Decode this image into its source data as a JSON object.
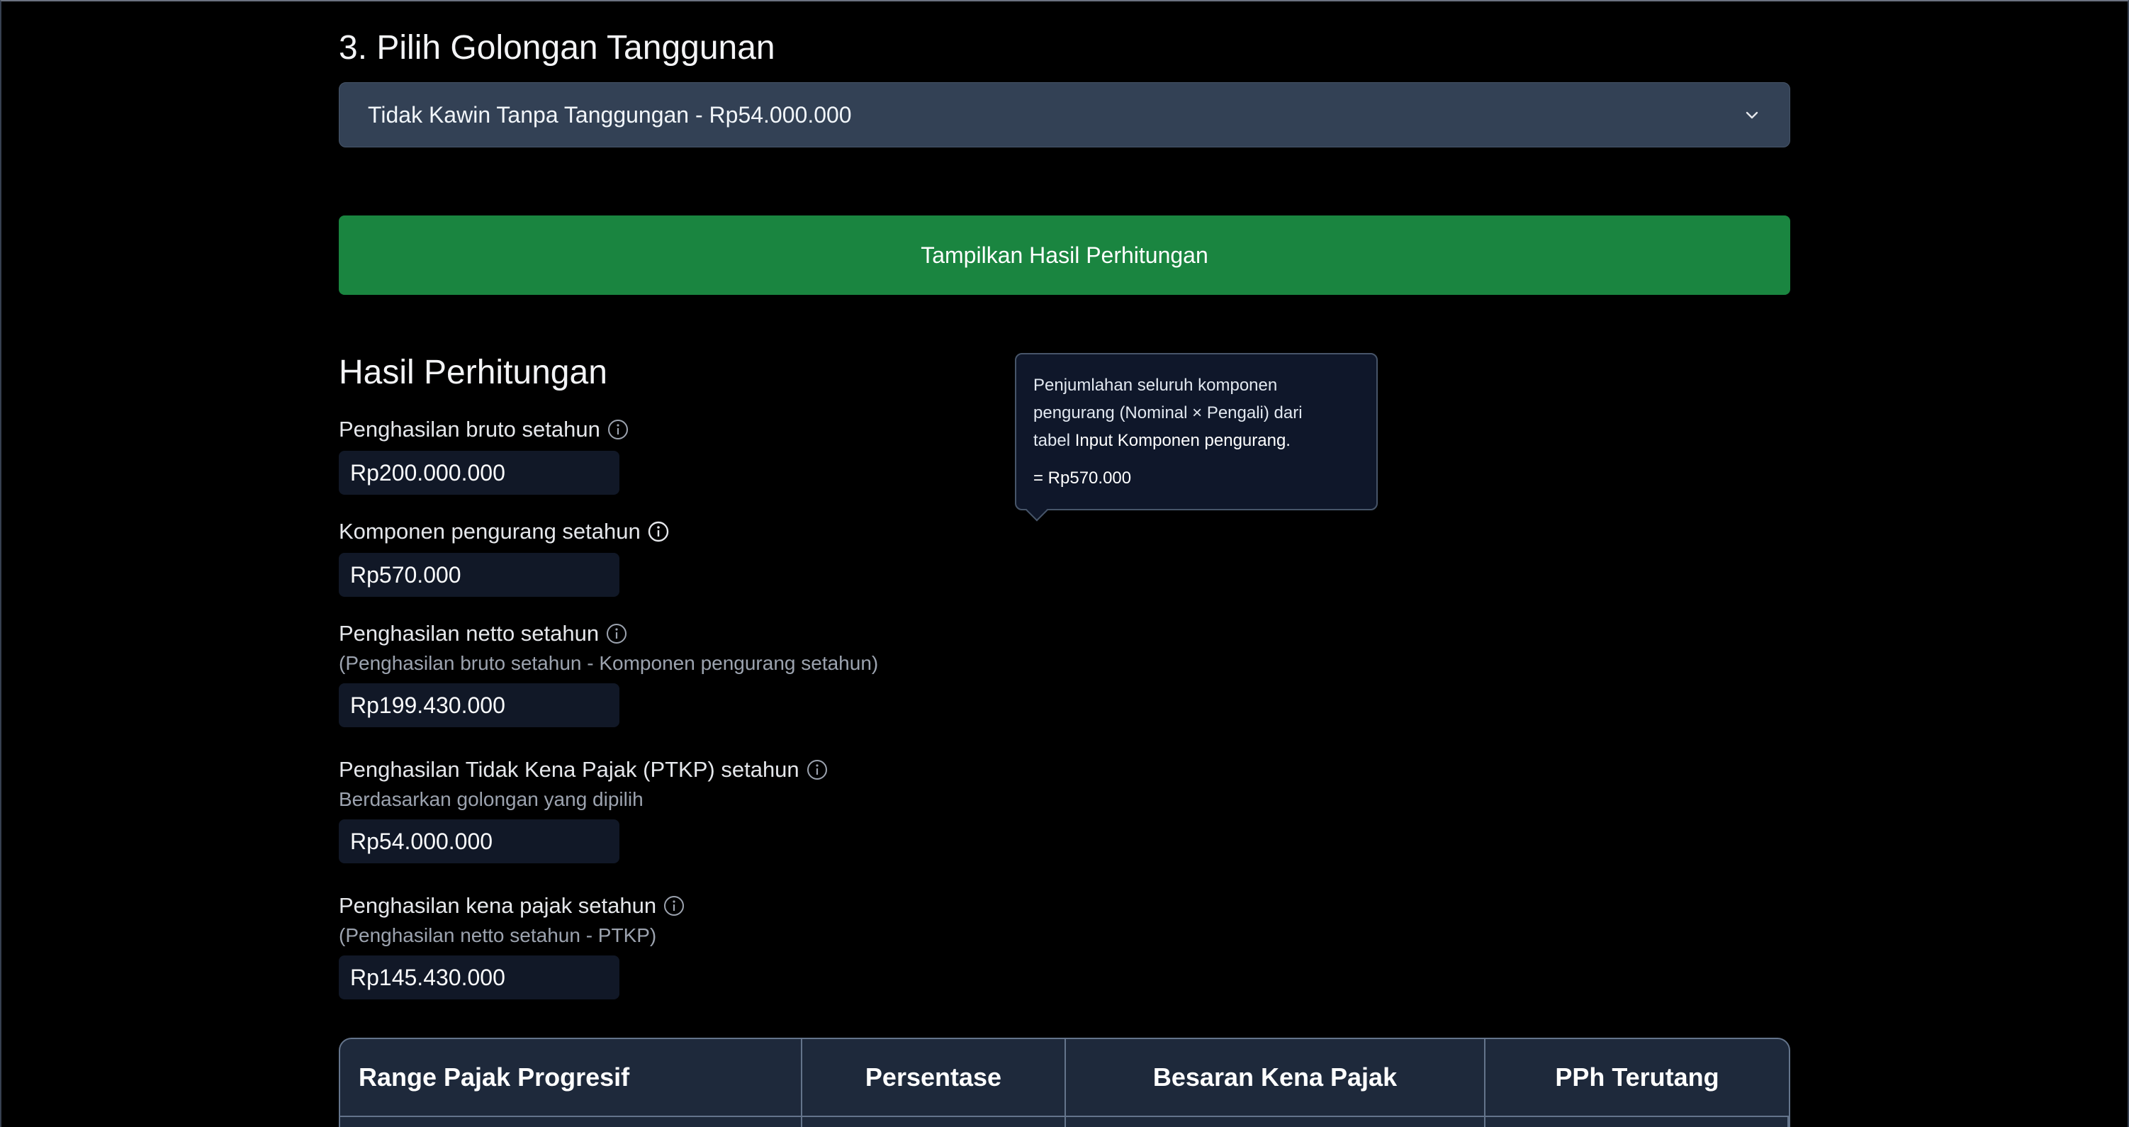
{
  "section3": {
    "title": "3. Pilih Golongan Tanggunan",
    "select_value": "Tidak Kawin Tanpa Tanggungan - Rp54.000.000"
  },
  "submit_label": "Tampilkan Hasil Perhitungan",
  "results": {
    "title": "Hasil Perhitungan",
    "gross": {
      "label": "Penghasilan bruto setahun",
      "value": "Rp200.000.000"
    },
    "deductions": {
      "label": "Komponen pengurang setahun",
      "value": "Rp570.000"
    },
    "net": {
      "label": "Penghasilan netto setahun",
      "subtitle": "(Penghasilan bruto setahun - Komponen pengurang setahun)",
      "value": "Rp199.430.000"
    },
    "ptkp": {
      "label": "Penghasilan Tidak Kena Pajak (PTKP) setahun",
      "subtitle": "Berdasarkan golongan yang dipilih",
      "value": "Rp54.000.000"
    },
    "taxable": {
      "label": "Penghasilan kena pajak setahun",
      "subtitle": "(Penghasilan netto setahun - PTKP)",
      "value": "Rp145.430.000"
    }
  },
  "tooltip": {
    "line1": "Penjumlahan seluruh komponen",
    "line2": "pengurang (Nominal × Pengali) dari",
    "line3_prefix": "tabel ",
    "line3_highlight": "Input Komponen pengurang.",
    "result": "= Rp570.000"
  },
  "table": {
    "headers": [
      "Range Pajak Progresif",
      "Persentase",
      "Besaran Kena Pajak",
      "PPh Terutang"
    ]
  },
  "colors": {
    "background": "#000000",
    "select_bg": "#334155",
    "button_green": "#1a8540",
    "value_box": "#111827",
    "table_header_bg": "#1e293b"
  },
  "icons": {
    "info": "info-circle-icon",
    "dropdown": "chevron-down-icon"
  }
}
